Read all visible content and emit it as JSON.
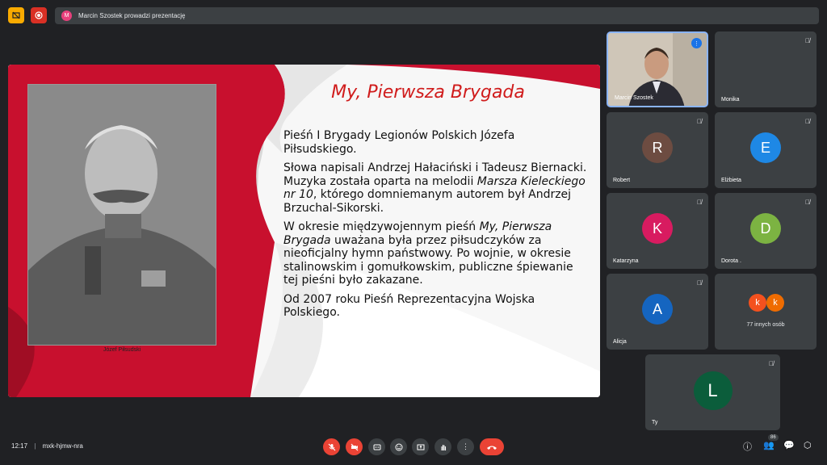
{
  "topbar": {
    "presenter_avatar": "M",
    "presenting_text": "Marcin Szostek prowadzi prezentację"
  },
  "slide": {
    "title": "My, Pierwsza Brygada",
    "caption": "Józef Piłsudski",
    "p1": "Pieśń I Brygady Legionów Polskich Józefa Piłsudskiego.",
    "p2_a": "Słowa napisali Andrzej Hałaciński i Tadeusz Biernacki. Muzyka została oparta na melodii ",
    "p2_i": "Marsza Kieleckiego nr 10",
    "p2_b": ", którego domniemanym autorem był Andrzej Brzuchal-Sikorski.",
    "p3_a": "W okresie międzywojennym pieśń ",
    "p3_i": "My, Pierwsza Brygada",
    "p3_b": " uważana była przez piłsudczyków za nieoficjalny hymn państwowy. Po wojnie, w okresie stalinowskim i gomułkowskim, publiczne śpiewanie tej pieśni było zakazane.",
    "p4": "Od 2007 roku Pieśń Reprezentacyjna Wojska Polskiego."
  },
  "participants": [
    {
      "name": "Marcin Szostek"
    },
    {
      "name": "Monika"
    },
    {
      "name": "Robert",
      "initial": "R",
      "color": "#6d4c41"
    },
    {
      "name": "Elżbieta",
      "initial": "E",
      "color": "#1e88e5"
    },
    {
      "name": "Katarzyna",
      "initial": "K",
      "color": "#d81b60"
    },
    {
      "name": "Dorota .",
      "initial": "D",
      "color": "#7cb342"
    },
    {
      "name": "Alicja",
      "initial": "A",
      "color": "#1565c0"
    },
    {
      "others_label": "77 innych osób",
      "mini1": "k",
      "mini2": "k"
    },
    {
      "name": "Ty",
      "initial": "L",
      "color": "#0b5d3b"
    }
  ],
  "bottombar": {
    "time": "12:17",
    "separator": "|",
    "meeting_code": "mxk-hjmw-nra",
    "people_count": "86"
  }
}
